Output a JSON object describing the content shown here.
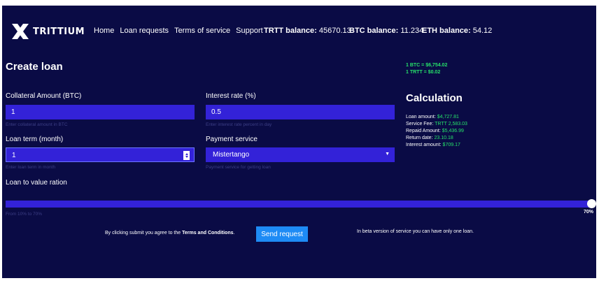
{
  "brand": {
    "logo_text": "TRITTIUM"
  },
  "nav": {
    "links": [
      "Home",
      "Loan requests",
      "Terms of service",
      "Support"
    ],
    "balances": [
      {
        "label": "TRTT balance:",
        "value": "45670.13"
      },
      {
        "label": "BTC balance:",
        "value": "11.234"
      },
      {
        "label": "ETH balance:",
        "value": "54.12"
      }
    ]
  },
  "page": {
    "title": "Create loan",
    "rates": [
      "1 BTC = $6,754.02",
      "1 TRTT = $0.02"
    ]
  },
  "form": {
    "collateral": {
      "label": "Collateral Amount (BTC)",
      "value": "1",
      "hint": "Enter collateral amount in BTC"
    },
    "interest": {
      "label": "Interest rate (%)",
      "value": "0.5",
      "hint": "Enter interest rate percent in day"
    },
    "term": {
      "label": "Loan term (month)",
      "value": "1",
      "hint": "Enter loan term in month"
    },
    "payment": {
      "label": "Payment service",
      "value": "Mistertango",
      "hint": "Payment service for getting loan"
    },
    "ltv": {
      "label": "Loan to value ration",
      "hint": "From 10% to 70%",
      "value_label": "70%",
      "min": 10,
      "max": 70,
      "value": 70
    }
  },
  "calculation": {
    "title": "Calculation",
    "rows": [
      {
        "label": "Loan amount:",
        "value": "$4,727.81"
      },
      {
        "label": "Service Fee:",
        "value": "TRTT 2,583.03"
      },
      {
        "label": "Repaid Amount:",
        "value": "$5,436.99"
      },
      {
        "label": "Return date:",
        "value": "23.10.18"
      },
      {
        "label": "Interest amount:",
        "value": "$709.17"
      }
    ]
  },
  "footer": {
    "agree_prefix": "By clicking submit you agree to the ",
    "agree_link": "Terms and Conditions",
    "agree_suffix": ".",
    "send_label": "Send request",
    "beta_note": "In beta version of service you can have only one loan."
  },
  "colors": {
    "background": "#0a0b45",
    "input": "#3322d8",
    "accent_green": "#27e36a",
    "button": "#1e8bf5"
  }
}
